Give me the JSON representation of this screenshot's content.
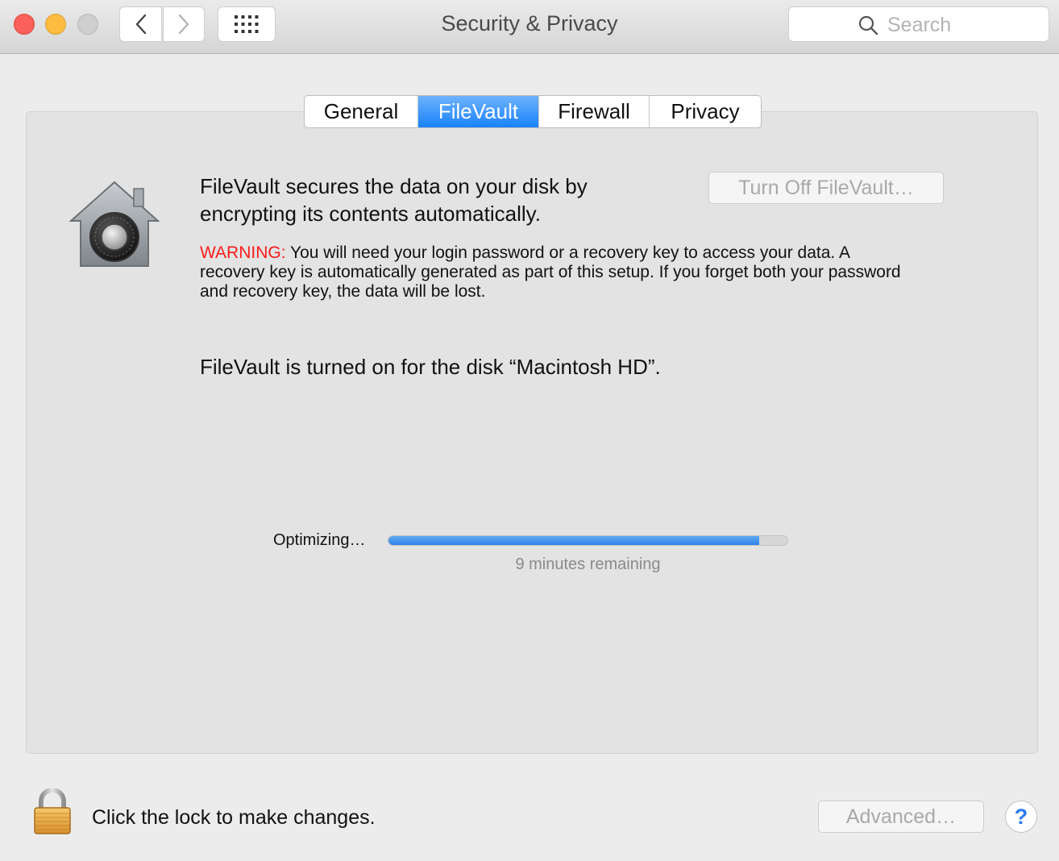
{
  "window": {
    "title": "Security & Privacy",
    "search_placeholder": "Search"
  },
  "tabs": [
    {
      "label": "General",
      "active": false
    },
    {
      "label": "FileVault",
      "active": true
    },
    {
      "label": "Firewall",
      "active": false
    },
    {
      "label": "Privacy",
      "active": false
    }
  ],
  "filevault": {
    "description": "FileVault secures the data on your disk by encrypting its contents automatically.",
    "warning_label": "WARNING:",
    "warning_text": " You will need your login password or a recovery key to access your data. A recovery key is automatically generated as part of this setup. If you forget both your password and recovery key, the data will be lost.",
    "turn_off_label": "Turn Off FileVault…",
    "status": "FileVault is turned on for the disk “Macintosh HD”.",
    "progress_label": "Optimizing…",
    "progress_fraction": 0.93,
    "remaining": "9 minutes remaining"
  },
  "footer": {
    "lock_text": "Click the lock to make changes.",
    "advanced_label": "Advanced…",
    "help_label": "?"
  },
  "icons": {
    "vault": "filevault-house-icon",
    "lock": "lock-icon",
    "search": "search-icon",
    "help": "help-icon"
  },
  "colors": {
    "accent": "#1a82fb",
    "warning": "#fb1c1c",
    "progress": "#2f83e9"
  }
}
